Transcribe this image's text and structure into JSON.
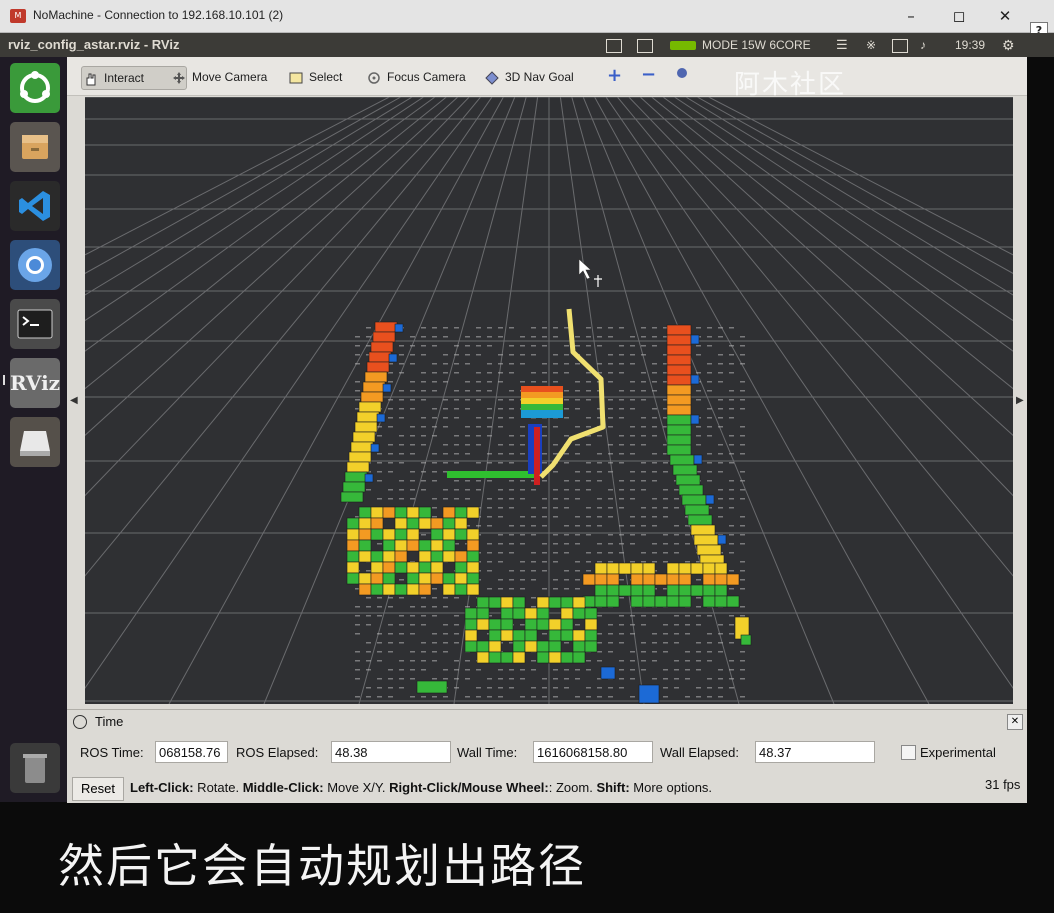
{
  "window": {
    "title": "NoMachine - Connection to 192.168.10.101 (2)",
    "help_label": "?"
  },
  "topbar": {
    "app_title": "rviz_config_astar.rviz - RViz",
    "nvidia_mode": "MODE 15W 6CORE",
    "clock": "19:39"
  },
  "launcher": {
    "items": [
      "ubuntu-dash",
      "files",
      "vscode",
      "chromium",
      "terminal",
      "rviz",
      "drive"
    ],
    "rviz_label": "RViz",
    "trash": "trash"
  },
  "toolbar": {
    "interact": "Interact",
    "move_camera": "Move Camera",
    "select": "Select",
    "focus_camera": "Focus Camera",
    "nav_goal": "3D Nav Goal"
  },
  "time_panel": {
    "title": "Time",
    "ros_time_label": "ROS Time:",
    "ros_time_value": "068158.76",
    "ros_elapsed_label": "ROS Elapsed:",
    "ros_elapsed_value": "48.38",
    "wall_time_label": "Wall Time:",
    "wall_time_value": "1616068158.80",
    "wall_elapsed_label": "Wall Elapsed:",
    "wall_elapsed_value": "48.37",
    "experimental_label": "Experimental",
    "experimental_checked": false
  },
  "status_bar": {
    "reset_label": "Reset",
    "hint_leftclick_key": "Left-Click:",
    "hint_leftclick": " Rotate. ",
    "hint_middle_key": "Middle-Click:",
    "hint_middle": " Move X/Y. ",
    "hint_right_key": "Right-Click/Mouse Wheel:",
    "hint_right": ": Zoom. ",
    "hint_shift_key": "Shift:",
    "hint_shift": " More options.",
    "fps": "31 fps"
  },
  "overlay": {
    "watermark": "阿木社区",
    "subtitle": "然后它会自动规划出路径"
  },
  "colors": {
    "viewport_bg": "#2f3033",
    "path": "#f0e070",
    "voxel_red": "#e8501e",
    "voxel_orange": "#f39a22",
    "voxel_yellow": "#f2d02a",
    "voxel_green": "#36b83a",
    "voxel_blue": "#1c6ad6"
  }
}
